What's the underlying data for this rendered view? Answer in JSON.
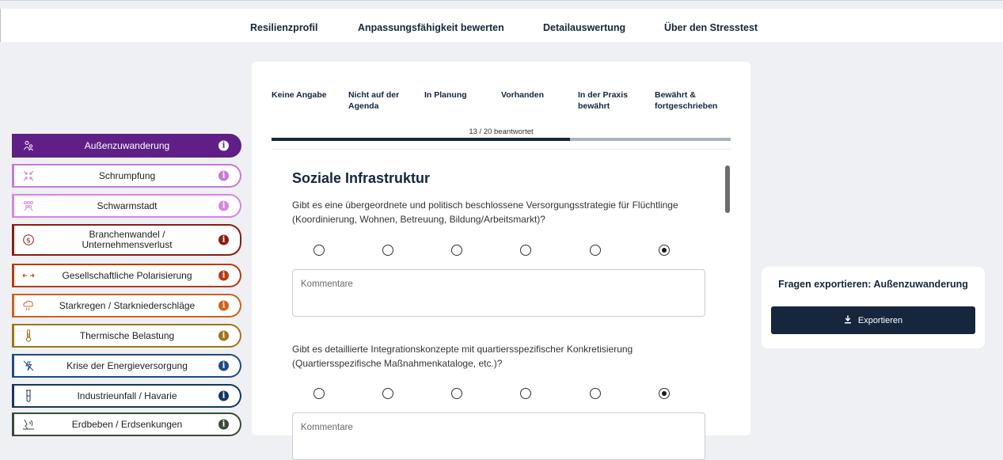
{
  "nav": {
    "items": [
      "Resilienzprofil",
      "Anpassungsfähigkeit bewerten",
      "Detailauswertung",
      "Über den Stresstest"
    ]
  },
  "sidebar": {
    "items": [
      {
        "label": "Außenzuwanderung",
        "color": "#5f1f86",
        "icon": "people-icon",
        "active": true
      },
      {
        "label": "Schrumpfung",
        "color": "#c57bd7",
        "icon": "shrink-arrows-icon",
        "active": false
      },
      {
        "label": "Schwarmstadt",
        "color": "#d884e2",
        "icon": "crowd-icon",
        "active": false
      },
      {
        "label": "Branchenwandel / Unternehmensverlust",
        "color": "#8b1d10",
        "icon": "money-cycle-icon",
        "active": false
      },
      {
        "label": "Gesellschaftliche Polarisierung",
        "color": "#b83b0d",
        "icon": "left-right-arrows-icon",
        "active": false
      },
      {
        "label": "Starkregen / Starkniederschläge",
        "color": "#d0601c",
        "icon": "rain-cloud-icon",
        "active": false
      },
      {
        "label": "Thermische Belastung",
        "color": "#a07417",
        "icon": "thermometer-icon",
        "active": false
      },
      {
        "label": "Krise der Energieversorgung",
        "color": "#1d4a86",
        "icon": "power-outage-icon",
        "active": false
      },
      {
        "label": "Industrieunfall / Havarie",
        "color": "#17375f",
        "icon": "test-tube-icon",
        "active": false
      },
      {
        "label": "Erdbeben / Erdsenkungen",
        "color": "#3a4a3a",
        "icon": "earthquake-icon",
        "active": false
      }
    ],
    "info_glyph": "i"
  },
  "main": {
    "scale_labels": [
      "Keine Angabe",
      "Nicht auf der Agenda",
      "In Planung",
      "Vorhanden",
      "In der Praxis bewährt",
      "Bewährt & fortgeschrieben"
    ],
    "progress": {
      "text": "13 / 20 beantwortet",
      "answered": 13,
      "total": 20
    },
    "section_title": "Soziale Infrastruktur",
    "questions": [
      {
        "text": "Gibt es eine übergeordnete und politisch beschlossene Versorgungsstrategie für Flüchtlinge (Koordinierung, Wohnen, Betreuung, Bildung/Arbeitsmarkt)?",
        "selected": 5,
        "comment_placeholder": "Kommentare"
      },
      {
        "text": "Gibt es detaillierte Integrationskonzepte mit quartiersspezifischer Konkretisierung (Quartiersspezifische Maßnahmenkataloge, etc.)?",
        "selected": 5,
        "comment_placeholder": "Kommentare"
      }
    ]
  },
  "export": {
    "title": "Fragen exportieren: Außenzuwanderung",
    "button_label": "Exportieren",
    "button_icon": "download-icon"
  }
}
